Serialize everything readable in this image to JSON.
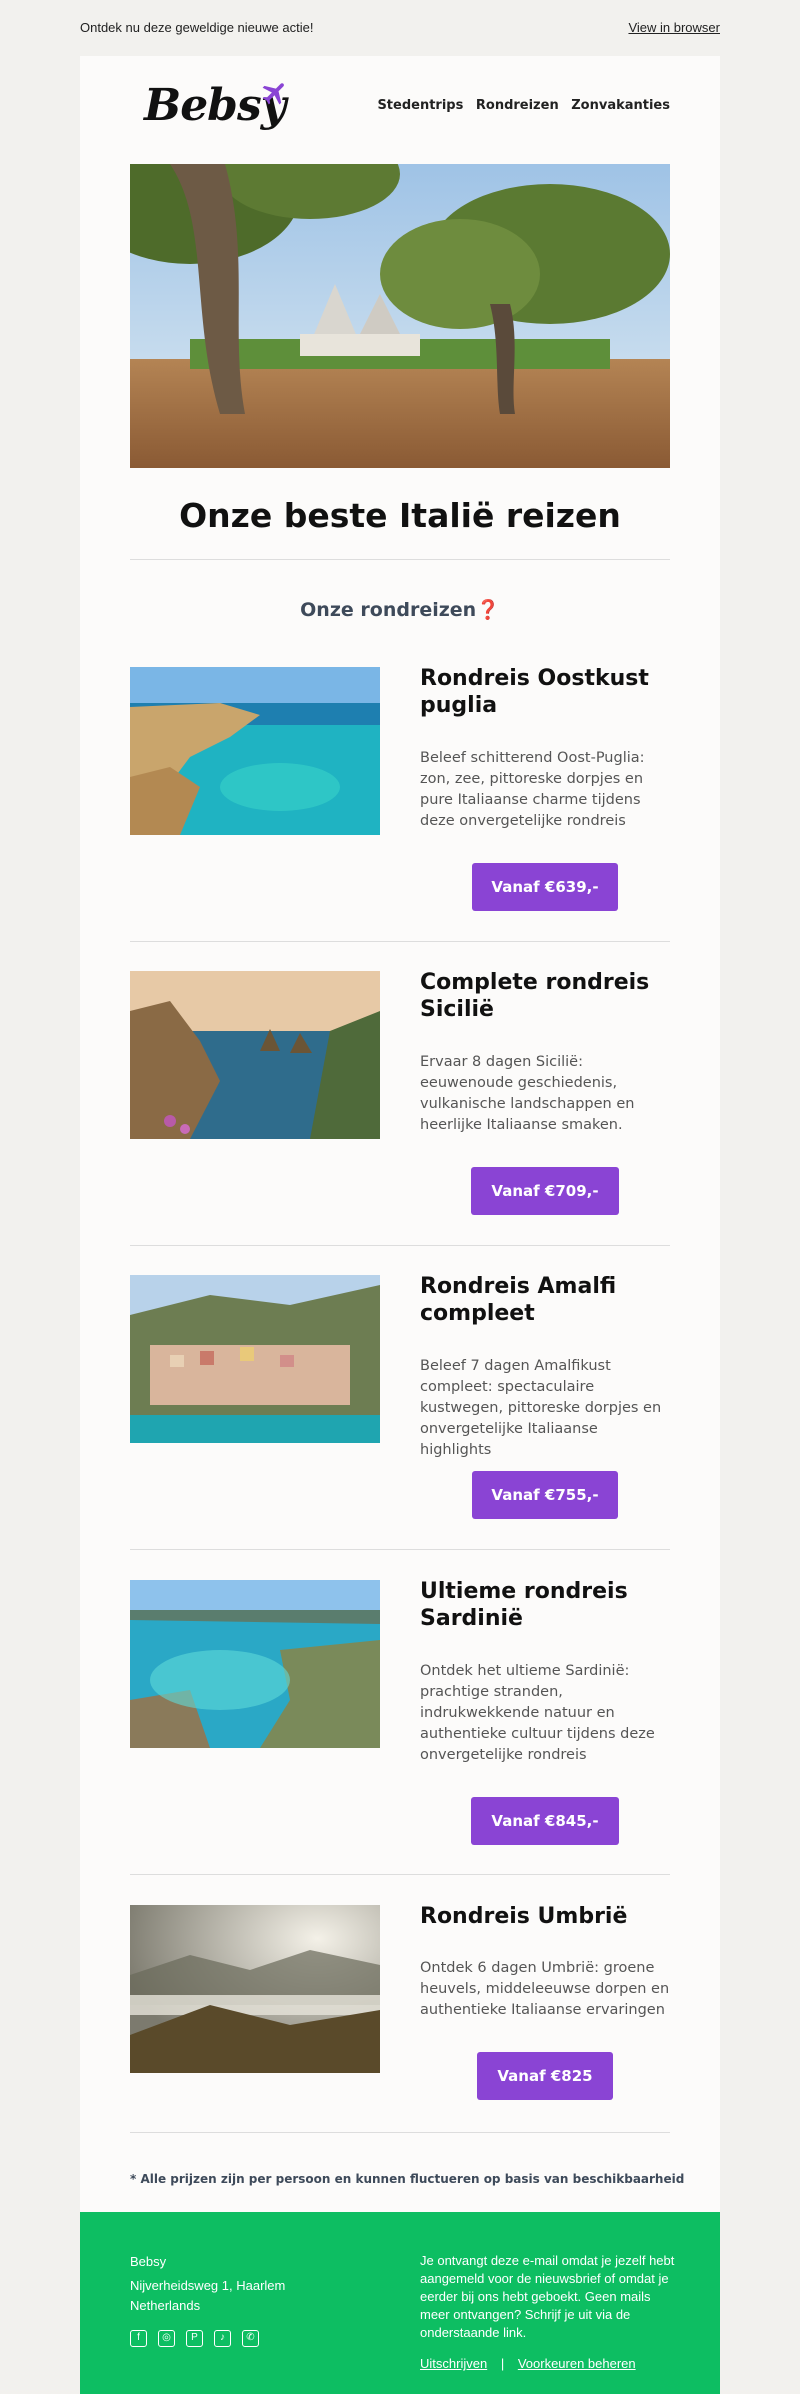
{
  "preheader": {
    "text": "Ontdek nu deze geweldige nieuwe actie!",
    "view_in_browser": "View in browser"
  },
  "brand": {
    "name": "Bebsy",
    "accent": "#8a44d4"
  },
  "nav": [
    "Stedentrips",
    "Rondreizen",
    "Zonvakanties"
  ],
  "headline": "Onze beste Italië reizen",
  "section_title": "Onze rondreizen❓",
  "trips": [
    {
      "name": "Rondreis Oostkust puglia",
      "description": "Beleef schitterend Oost-Puglia: zon, zee, pittoreske dorpjes en pure Italiaanse charme tijdens deze onvergetelijke rondreis",
      "price": "Vanaf €639,-"
    },
    {
      "name": "Complete rondreis Sicilië",
      "description": "Ervaar 8 dagen Sicilië: eeuwenoude geschiedenis, vulkanische landschappen en heerlijke Italiaanse smaken.",
      "price": "Vanaf €709,-"
    },
    {
      "name": "Rondreis Amalfi compleet",
      "description": "Beleef 7 dagen Amalfikust compleet: spectaculaire kustwegen, pittoreske dorpjes en onvergetelijke Italiaanse highlights",
      "price": "Vanaf €755,-"
    },
    {
      "name": "Ultieme rondreis Sardinië",
      "description": "Ontdek het ultieme Sardinië: prachtige stranden, indrukwekkende natuur en authentieke cultuur tijdens deze onvergetelijke rondreis",
      "price": "Vanaf €845,-"
    },
    {
      "name": "Rondreis Umbrië",
      "description": "Ontdek 6 dagen Umbrië: groene heuvels, middeleeuwse dorpen en authentieke Italiaanse ervaringen",
      "price": "Vanaf €825"
    }
  ],
  "disclaimer": "* Alle prijzen zijn per persoon en kunnen fluctueren op basis van beschikbaarheid",
  "footer": {
    "company": "Bebsy",
    "address_line1": "Nijverheidsweg 1, Haarlem",
    "address_line2": "Netherlands",
    "info": "Je ontvangt deze e-mail omdat je jezelf hebt aangemeld voor de nieuwsbrief of omdat je eerder bij ons hebt geboekt. Geen mails meer ontvangen? Schrijf je uit via de onderstaande link.",
    "unsubscribe": "Uitschrijven",
    "separator": "|",
    "preferences": "Voorkeuren beheren",
    "social_icons": [
      "facebook-icon",
      "instagram-icon",
      "pinterest-icon",
      "tiktok-icon",
      "whatsapp-icon"
    ],
    "bg_color": "#0dbe62"
  }
}
